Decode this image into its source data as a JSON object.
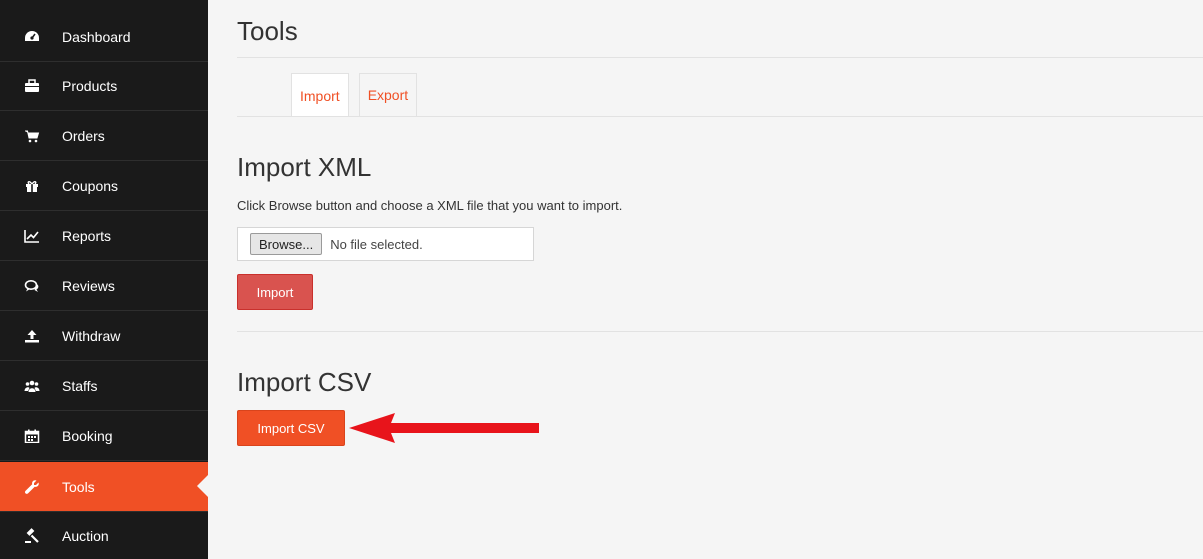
{
  "sidebar": {
    "items": [
      {
        "label": "Dashboard",
        "icon": "dashboard-icon"
      },
      {
        "label": "Products",
        "icon": "briefcase-icon"
      },
      {
        "label": "Orders",
        "icon": "cart-icon"
      },
      {
        "label": "Coupons",
        "icon": "gift-icon"
      },
      {
        "label": "Reports",
        "icon": "line-chart-icon"
      },
      {
        "label": "Reviews",
        "icon": "comments-icon"
      },
      {
        "label": "Withdraw",
        "icon": "upload-icon"
      },
      {
        "label": "Staffs",
        "icon": "users-icon"
      },
      {
        "label": "Booking",
        "icon": "calendar-icon"
      },
      {
        "label": "Tools",
        "icon": "wrench-icon",
        "active": true
      },
      {
        "label": "Auction",
        "icon": "gavel-icon"
      }
    ],
    "active_color": "#f05025"
  },
  "main": {
    "title": "Tools",
    "tabs": [
      {
        "label": "Import",
        "active": true
      },
      {
        "label": "Export",
        "active": false
      }
    ],
    "import_xml": {
      "heading": "Import XML",
      "description": "Click Browse button and choose a XML file that you want to import.",
      "browse_label": "Browse...",
      "file_status": "No file selected.",
      "button_label": "Import"
    },
    "import_csv": {
      "heading": "Import CSV",
      "button_label": "Import CSV"
    }
  },
  "colors": {
    "accent": "#f05025",
    "danger": "#d9534f",
    "sidebar_bg": "#1a1a1a",
    "annotation_arrow": "#e8141b"
  }
}
